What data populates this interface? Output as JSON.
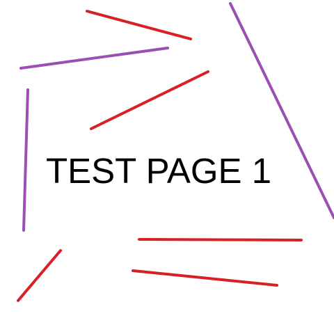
{
  "page": {
    "title": "TEST PAGE 1",
    "background_color": "#ffffff"
  },
  "strokes": {
    "red_color": "#d92027",
    "purple_color": "#9b4fb3"
  }
}
